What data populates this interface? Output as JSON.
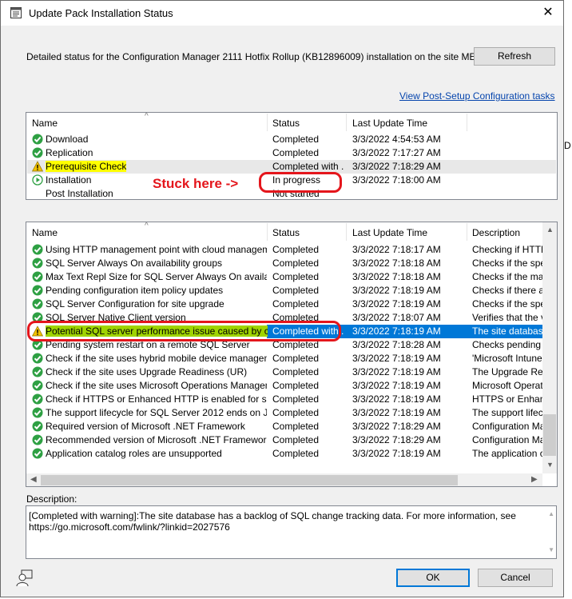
{
  "window": {
    "title": "Update Pack Installation Status",
    "close_label": "✕"
  },
  "edge_fragment": "D",
  "detail_text": "Detailed status for the Configuration Manager 2111 Hotfix Rollup (KB12896009) installation on the site MEM:",
  "buttons": {
    "refresh": "Refresh",
    "ok": "OK",
    "cancel": "Cancel"
  },
  "link": "View Post-Setup Configuration tasks",
  "annotation": {
    "text": "Stuck here ->",
    "color": "#e4161c"
  },
  "colors": {
    "accent": "#0078d7",
    "highlight": "#ffff00",
    "success": "#2ea043",
    "warning": "#f2c200"
  },
  "top_list": {
    "columns": [
      "Name",
      "Status",
      "Last Update Time"
    ],
    "rows": [
      {
        "icon": "check-icon",
        "name": "Download",
        "status": "Completed",
        "time": "3/3/2022 4:54:53 AM"
      },
      {
        "icon": "check-icon",
        "name": "Replication",
        "status": "Completed",
        "time": "3/3/2022 7:17:27 AM"
      },
      {
        "icon": "warning-icon",
        "name": "Prerequisite Check",
        "status": "Completed with ...",
        "time": "3/3/2022 7:18:29 AM"
      },
      {
        "icon": "play-icon",
        "name": "Installation",
        "status": "In progress",
        "time": "3/3/2022 7:18:00 AM"
      },
      {
        "icon": "",
        "name": "Post Installation",
        "status": "Not started",
        "time": ""
      }
    ]
  },
  "bottom_list": {
    "columns": [
      "Name",
      "Status",
      "Last Update Time",
      "Description"
    ],
    "rows": [
      {
        "icon": "check-icon",
        "name": "Using HTTP management point with cloud management ...",
        "status": "Completed",
        "time": "3/3/2022 7:18:17 AM",
        "desc": "Checking if HTTP"
      },
      {
        "icon": "check-icon",
        "name": "SQL Server Always On availability groups",
        "status": "Completed",
        "time": "3/3/2022 7:18:18 AM",
        "desc": "Checks if the spec"
      },
      {
        "icon": "check-icon",
        "name": "Max Text Repl Size for SQL Server Always On availabilit...",
        "status": "Completed",
        "time": "3/3/2022 7:18:18 AM",
        "desc": "Checks if the max t"
      },
      {
        "icon": "check-icon",
        "name": "Pending configuration item policy updates",
        "status": "Completed",
        "time": "3/3/2022 7:18:19 AM",
        "desc": "Checks if there are"
      },
      {
        "icon": "check-icon",
        "name": "SQL Server Configuration for site upgrade",
        "status": "Completed",
        "time": "3/3/2022 7:18:19 AM",
        "desc": "Checks if the spec"
      },
      {
        "icon": "check-icon",
        "name": "SQL Server Native Client version",
        "status": "Completed",
        "time": "3/3/2022 7:18:07 AM",
        "desc": "Verifies that the ve"
      },
      {
        "icon": "warning-icon",
        "name": "Potential SQL server performance issue caused by chan...",
        "status": "Completed with ...",
        "time": "3/3/2022 7:18:19 AM",
        "desc": "The site database"
      },
      {
        "icon": "check-icon",
        "name": "Pending system restart on a remote SQL Server",
        "status": "Completed",
        "time": "3/3/2022 7:18:28 AM",
        "desc": "Checks pending sy"
      },
      {
        "icon": "check-icon",
        "name": "Check if the site uses hybrid mobile device management ...",
        "status": "Completed",
        "time": "3/3/2022 7:18:19 AM",
        "desc": "'Microsoft Intune S"
      },
      {
        "icon": "check-icon",
        "name": "Check if the site uses Upgrade Readiness (UR)",
        "status": "Completed",
        "time": "3/3/2022 7:18:19 AM",
        "desc": "The Upgrade Read"
      },
      {
        "icon": "check-icon",
        "name": "Check if the site uses Microsoft Operations Management...",
        "status": "Completed",
        "time": "3/3/2022 7:18:19 AM",
        "desc": "Microsoft Operation"
      },
      {
        "icon": "check-icon",
        "name": "Check if HTTPS or Enhanced HTTP is enabled for site s...",
        "status": "Completed",
        "time": "3/3/2022 7:18:19 AM",
        "desc": "HTTPS or Enhance"
      },
      {
        "icon": "check-icon",
        "name": "The support lifecycle for SQL Server 2012 ends on July ...",
        "status": "Completed",
        "time": "3/3/2022 7:18:19 AM",
        "desc": "The support lifecyc"
      },
      {
        "icon": "check-icon",
        "name": "Required version of Microsoft .NET Framework",
        "status": "Completed",
        "time": "3/3/2022 7:18:29 AM",
        "desc": "Configuration Mana"
      },
      {
        "icon": "check-icon",
        "name": "Recommended version of Microsoft .NET Framework",
        "status": "Completed",
        "time": "3/3/2022 7:18:29 AM",
        "desc": "Configuration Mana"
      },
      {
        "icon": "check-icon",
        "name": "Application catalog roles are unsupported",
        "status": "Completed",
        "time": "3/3/2022 7:18:19 AM",
        "desc": "The application ca"
      }
    ]
  },
  "description": {
    "label": "Description:",
    "text": "[Completed with warning]:The site database has a backlog of SQL change tracking data. For more information, see https://go.microsoft.com/fwlink/?linkid=2027576"
  }
}
